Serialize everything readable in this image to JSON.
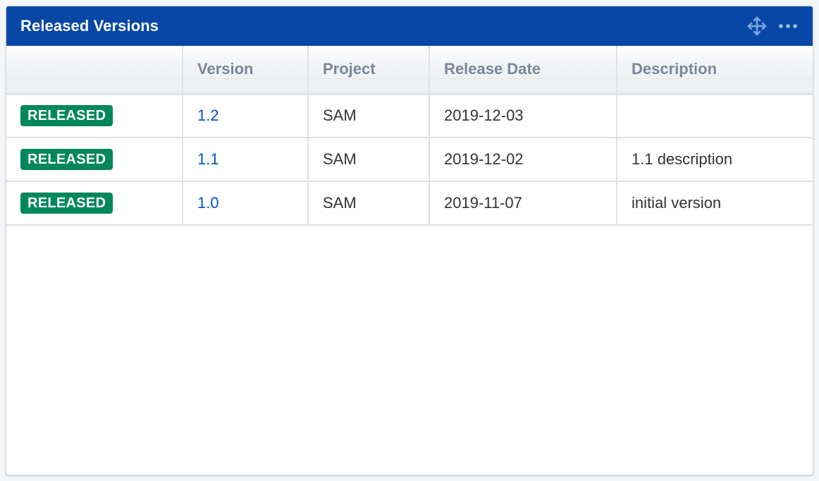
{
  "gadget": {
    "title": "Released Versions",
    "move_icon": "move-arrows-icon",
    "more_icon": "more-ellipsis-icon",
    "colors": {
      "header_bg": "#0747a6",
      "lozenge_bg": "#00875a",
      "link": "#0052cc",
      "header_text": "#7a869a"
    }
  },
  "table": {
    "columns": [
      "",
      "Version",
      "Project",
      "Release Date",
      "Description"
    ],
    "rows": [
      {
        "status": "RELEASED",
        "version": "1.2",
        "project": "SAM",
        "release_date": "2019-12-03",
        "description": ""
      },
      {
        "status": "RELEASED",
        "version": "1.1",
        "project": "SAM",
        "release_date": "2019-12-02",
        "description": "1.1 description"
      },
      {
        "status": "RELEASED",
        "version": "1.0",
        "project": "SAM",
        "release_date": "2019-11-07",
        "description": "initial version"
      }
    ]
  }
}
